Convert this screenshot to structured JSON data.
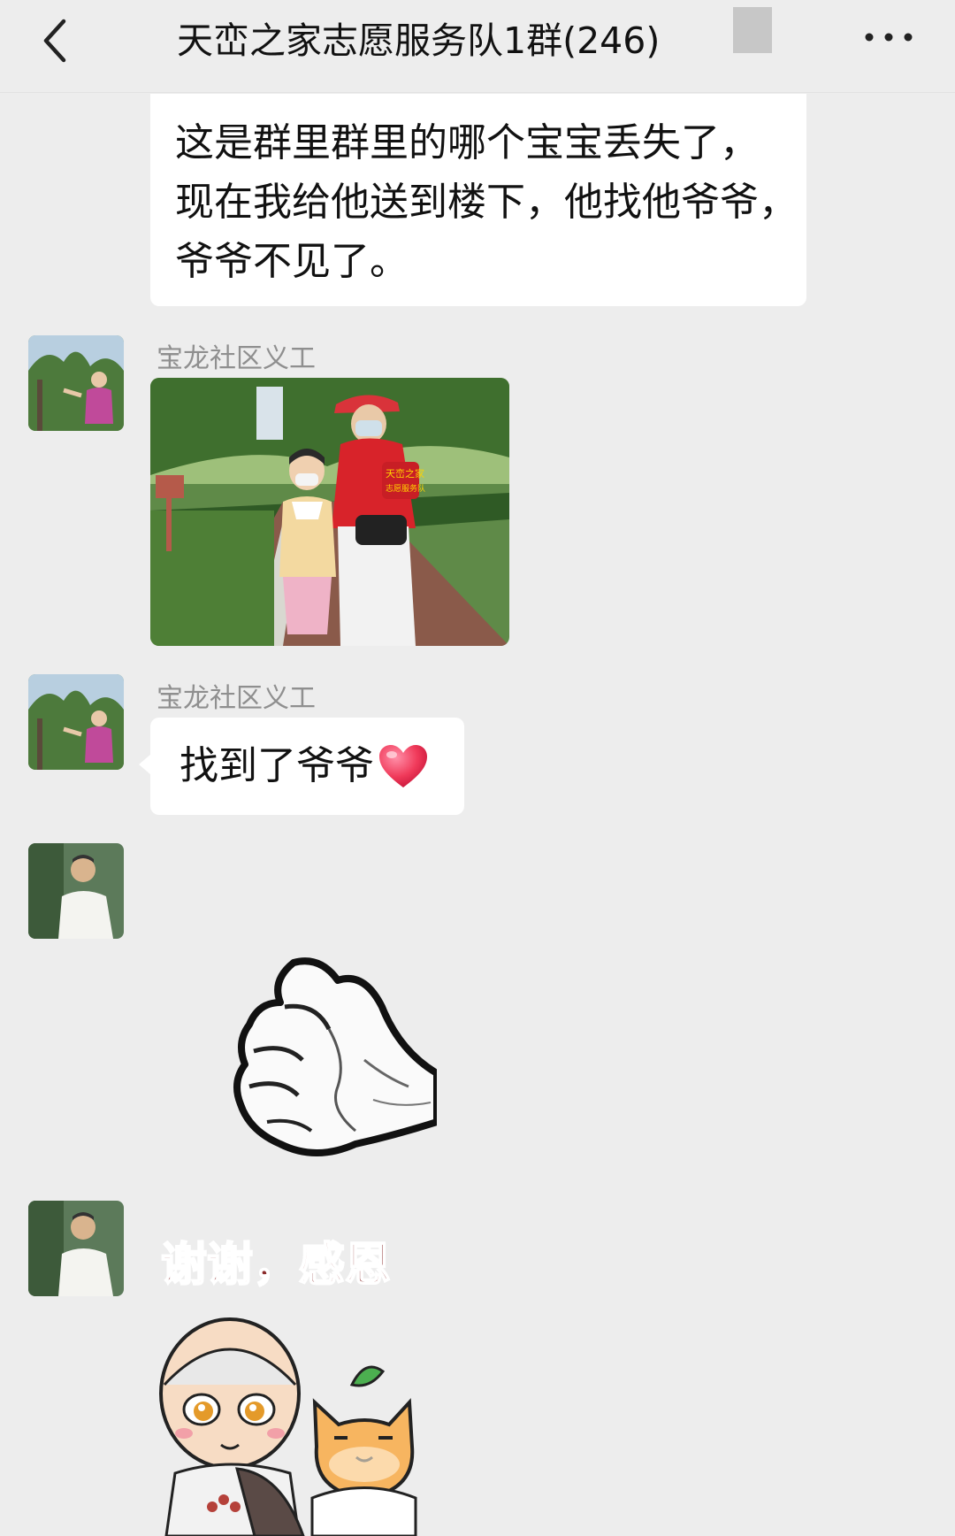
{
  "header": {
    "title": "天峦之家志愿服务队1群(246)",
    "back_icon": "chevron-left-icon",
    "more_icon": "more-dots-icon"
  },
  "messages": [
    {
      "type": "text",
      "lines": [
        "这是群里群里的哪个宝宝丢失了，",
        "现在我给他送到楼下，他找他爷爷，",
        "爷爷不见了。"
      ]
    },
    {
      "type": "image",
      "sender": "宝龙社区义工",
      "image_desc": "volunteer-with-child-photo",
      "armband_text": [
        "天峦之家",
        "志愿服务队"
      ]
    },
    {
      "type": "text",
      "sender": "宝龙社区义工",
      "text": "找到了爷爷",
      "emoji": "red-heart-icon"
    },
    {
      "type": "sticker",
      "sender": "",
      "sticker": "fist-sticker"
    },
    {
      "type": "sticker",
      "sender": "",
      "sticker": "thanks-sticker",
      "sticker_text": "谢谢，感恩"
    }
  ],
  "colors": {
    "background": "#ededed",
    "bubble": "#ffffff",
    "sender_name": "#8f8f8f",
    "sticker_text": "#8a2a2a"
  }
}
